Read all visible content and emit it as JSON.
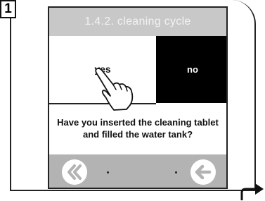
{
  "step": {
    "number": "1"
  },
  "screen": {
    "title": "1.4.2. cleaning cycle",
    "options": {
      "yes": "yes",
      "no": "no"
    },
    "question": {
      "line1": "Have you inserted the cleaning tablet",
      "line2": "and filled the water tank?"
    }
  },
  "navigation": {
    "first_icon": "double-chevron-left-icon",
    "back_icon": "arrow-left-icon"
  },
  "colors": {
    "title_bar": "#c8c8c8",
    "nav_bar": "#b3b3b3",
    "selected_option": "#000000"
  }
}
